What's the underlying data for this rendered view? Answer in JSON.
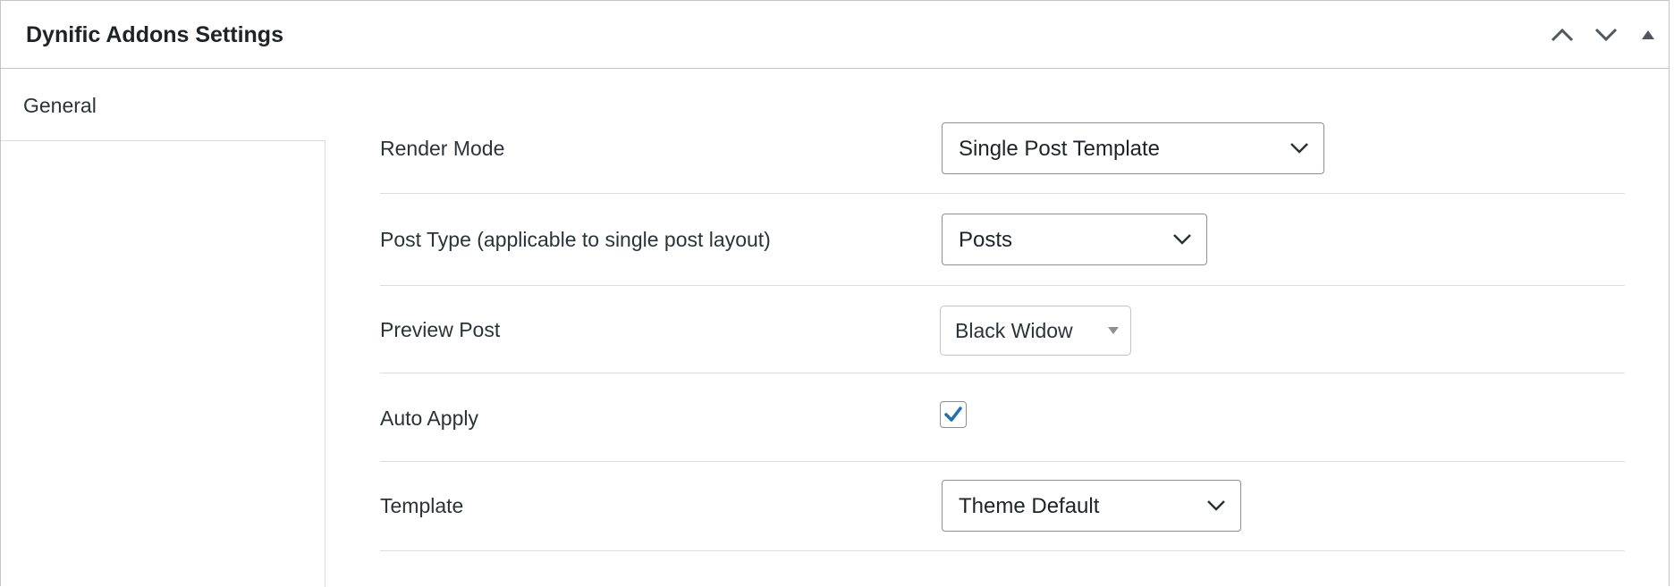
{
  "panel": {
    "title": "Dynific Addons Settings",
    "controls": {
      "move_up": "chevron-up-icon",
      "move_down": "chevron-down-icon",
      "toggle": "triangle-up-icon"
    }
  },
  "tabs": [
    {
      "label": "General",
      "active": true
    }
  ],
  "fields": {
    "render_mode": {
      "label": "Render Mode",
      "value": "Single Post Template"
    },
    "post_type": {
      "label": "Post Type (applicable to single post layout)",
      "value": "Posts"
    },
    "preview_post": {
      "label": "Preview Post",
      "value": "Black Widow"
    },
    "auto_apply": {
      "label": "Auto Apply",
      "checked": true
    },
    "template": {
      "label": "Template",
      "value": "Theme Default"
    }
  },
  "colors": {
    "border": "#c3c4c7",
    "text": "#1d2327",
    "checkmark": "#2271b1"
  }
}
